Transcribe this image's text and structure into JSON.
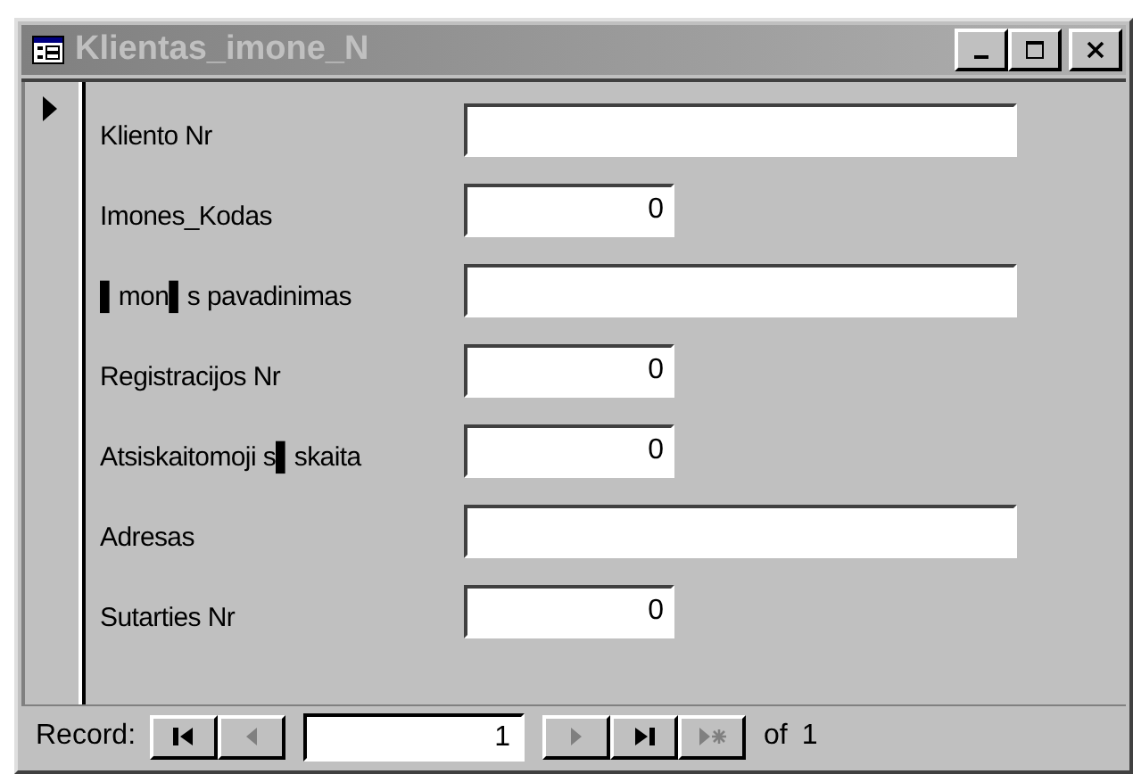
{
  "window": {
    "title": "Klientas_imone_N",
    "active": false
  },
  "record_selector": {
    "current": true
  },
  "fields": [
    {
      "label": "Kliento Nr",
      "kind": "wide"
    },
    {
      "label": "Imones_Kodas",
      "value": "0",
      "kind": "narrow"
    },
    {
      "label": "▌mon▌s pavadinimas",
      "kind": "wide"
    },
    {
      "label": "Registracijos Nr",
      "value": "0",
      "kind": "narrow"
    },
    {
      "label": "Atsiskaitomoji s▌skaita",
      "value": "0",
      "kind": "narrow"
    },
    {
      "label": "Adresas",
      "kind": "wide"
    },
    {
      "label": "Sutarties Nr",
      "value": "0",
      "kind": "narrow"
    }
  ],
  "navigation": {
    "label": "Record:",
    "buttons": [
      {
        "kind": "first",
        "disabled": false
      },
      {
        "kind": "prev",
        "disabled": true
      }
    ],
    "current": "1",
    "buttons_after": [
      {
        "kind": "next",
        "disabled": true
      },
      {
        "kind": "last",
        "disabled": false
      },
      {
        "kind": "new",
        "disabled": true
      }
    ],
    "of_label": "of",
    "total": "1"
  }
}
